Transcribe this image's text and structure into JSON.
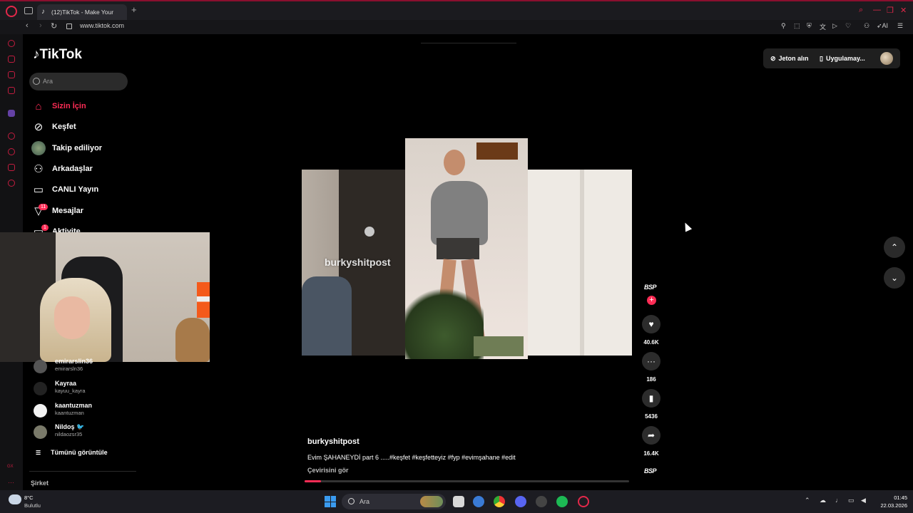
{
  "browser": {
    "tab_title": "(12)TikTok - Make Your",
    "url": "www.tiktok.com",
    "ai_label": "AI",
    "colors": {
      "accent": "#e3284a"
    }
  },
  "tiktok": {
    "logo": "TikTok",
    "search_placeholder": "Ara",
    "nav": [
      {
        "label": "Sizin İçin",
        "icon": "home-icon",
        "active": true
      },
      {
        "label": "Keşfet",
        "icon": "compass-icon"
      },
      {
        "label": "Takip ediliyor",
        "icon": "avatar"
      },
      {
        "label": "Arkadaşlar",
        "icon": "friends-icon"
      },
      {
        "label": "CANLI Yayın",
        "icon": "live-tv-icon"
      },
      {
        "label": "Mesajlar",
        "icon": "send-icon",
        "badge": "11"
      },
      {
        "label": "Aktivite",
        "icon": "inbox-icon",
        "badge": "1"
      }
    ],
    "following": [
      {
        "name": "emirarslin36",
        "handle": "emirarsln36"
      },
      {
        "name": "Kayraa",
        "handle": "kayuu_kayra"
      },
      {
        "name": "kaantuzman",
        "handle": "kaantuzman"
      },
      {
        "name": "Nildoş 🐦",
        "handle": "nildaozsr35"
      }
    ],
    "see_all": "Tümünü görüntüle",
    "company": "Şirket",
    "top_right": {
      "coins": "Jeton alın",
      "app": "Uygulamay..."
    },
    "video": {
      "watermark": "burkyshitpost",
      "author": "burkyshitpost",
      "description": "Evim ŞAHANEYDİ part 6 .....#keşfet #keşfetteyiz #fyp #evimşahane #edit",
      "translate": "Çevirisini gör",
      "progress": 0.05
    },
    "actions": {
      "creator_badge": "BSP",
      "likes": "40.6K",
      "comments": "186",
      "saves": "5436",
      "shares": "16.4K",
      "music_badge": "BSP"
    },
    "colors": {
      "brand": "#fe2c55"
    }
  },
  "taskbar": {
    "weather_temp": "8°C",
    "weather_desc": "Bulutlu",
    "search_label": "Ara",
    "time": "01:45",
    "date": "22.03.2026"
  }
}
